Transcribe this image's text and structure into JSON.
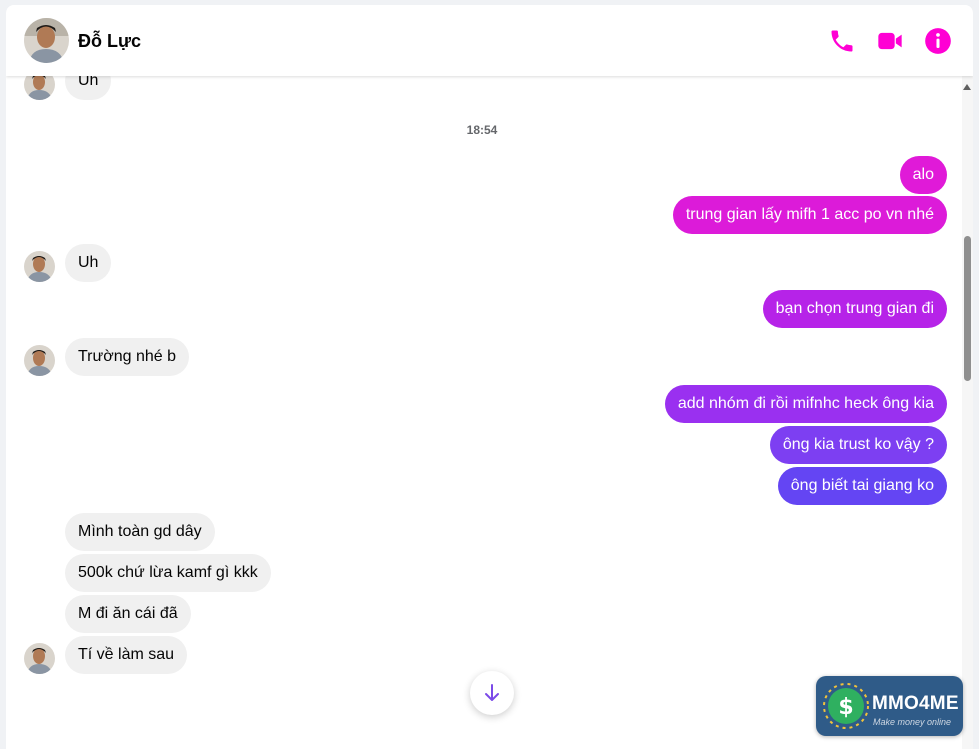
{
  "header": {
    "contact_name": "Đỗ Lực",
    "icons": [
      "phone-icon",
      "video-call-icon",
      "info-icon"
    ],
    "accent_color": "#ff00d4"
  },
  "conversation": {
    "clipped_top_message": "Uh",
    "timestamp": "18:54",
    "messages": [
      {
        "from": "me",
        "text": "alo"
      },
      {
        "from": "me",
        "text": "trung gian lấy mifh 1 acc po vn nhé"
      },
      {
        "from": "them",
        "text": "Uh"
      },
      {
        "from": "me",
        "text": "bạn chọn trung gian đi"
      },
      {
        "from": "them",
        "text": "Trường nhé b"
      },
      {
        "from": "me",
        "text": "add nhóm đi rồi mifnhc heck ông kia"
      },
      {
        "from": "me",
        "text": "ông kia trust ko vậy ?"
      },
      {
        "from": "me",
        "text": "ông biết tai giang ko"
      },
      {
        "from": "them",
        "text": "Mình toàn gd dây"
      },
      {
        "from": "them",
        "text": "500k chứ lừa kamf gì kkk"
      },
      {
        "from": "them",
        "text": "M đi ăn cái đã"
      },
      {
        "from": "them",
        "text": "Tí về làm sau"
      }
    ]
  },
  "bubble_colors": {
    "outgoing_gradient": [
      "#e01ad8",
      "#c41fe3",
      "#9f2ff0",
      "#8a3bf2",
      "#6f43f3",
      "#5f47f3"
    ],
    "incoming": "#f0f0f0"
  },
  "watermark": {
    "brand": "MMO4ME",
    "tagline": "Make money online"
  }
}
